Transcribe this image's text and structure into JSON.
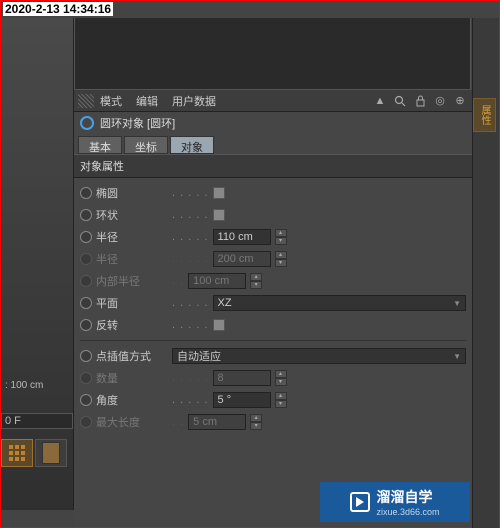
{
  "timestamp": "2020-2-13 14:34:16",
  "header": {
    "menu_mode": "模式",
    "menu_edit": "编辑",
    "menu_userdata": "用户数据"
  },
  "object": {
    "title": "圆环对象 [圆环]"
  },
  "tabs": {
    "basic": "基本",
    "coord": "坐标",
    "object": "对象"
  },
  "section": {
    "props": "对象属性"
  },
  "props": {
    "ellipse": "椭圆",
    "ring": "环状",
    "radius": "半径",
    "radius_val": "110 cm",
    "radius2": "半径",
    "radius2_val": "200 cm",
    "inner_radius": "内部半径",
    "inner_radius_val": "100 cm",
    "plane": "平面",
    "plane_val": "XZ",
    "reverse": "反转",
    "interp": "点插值方式",
    "interp_val": "自动适应",
    "count": "数量",
    "count_val": "8",
    "angle": "角度",
    "angle_val": "5 °",
    "maxlen": "最大长度",
    "maxlen_val": "5 cm"
  },
  "left": {
    "grid": ": 100 cm",
    "frame": "0 F"
  },
  "right_tab": "属性",
  "watermark": {
    "brand": "溜溜自学",
    "url": "zixue.3d66.com"
  }
}
